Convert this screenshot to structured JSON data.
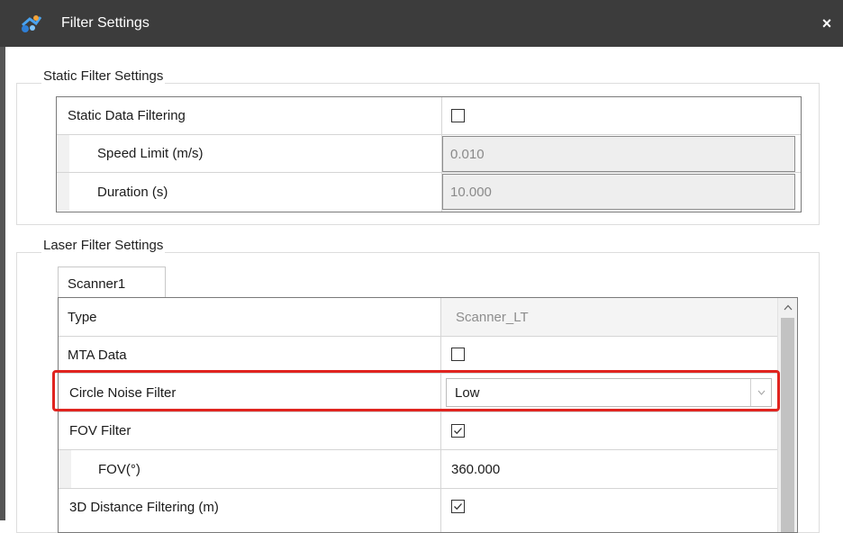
{
  "window": {
    "title": "Filter Settings",
    "close_label": "×"
  },
  "static_group": {
    "legend": "Static Filter Settings",
    "rows": [
      {
        "label": "Static Data Filtering",
        "type": "checkbox",
        "checked": false
      },
      {
        "label": "Speed Limit (m/s)",
        "type": "readonly",
        "value": "0.010"
      },
      {
        "label": "Duration (s)",
        "type": "readonly",
        "value": "10.000"
      }
    ]
  },
  "laser_group": {
    "legend": "Laser Filter Settings",
    "tabs": [
      {
        "label": "Scanner1",
        "selected": true
      }
    ],
    "rows": [
      {
        "label": "Type",
        "type": "readonly-text",
        "value": "Scanner_LT"
      },
      {
        "label": "MTA Data",
        "type": "checkbox",
        "checked": false
      },
      {
        "label": "Circle Noise Filter",
        "type": "select",
        "value": "Low",
        "highlighted": true
      },
      {
        "label": "FOV Filter",
        "type": "checkbox",
        "checked": true
      },
      {
        "label": "FOV(°)",
        "type": "text",
        "value": "360.000"
      },
      {
        "label": "3D Distance Filtering (m)",
        "type": "checkbox",
        "checked": true
      }
    ]
  },
  "colors": {
    "titlebar": "#3c3c3c",
    "highlight": "#e0241f",
    "readonly_bg": "#eeeeee"
  },
  "icons": {
    "app": "scanner-app-icon",
    "close": "close-icon",
    "check": "checkmark-icon",
    "dropdown": "chevron-down-icon",
    "scroll_up": "chevron-up-icon"
  }
}
